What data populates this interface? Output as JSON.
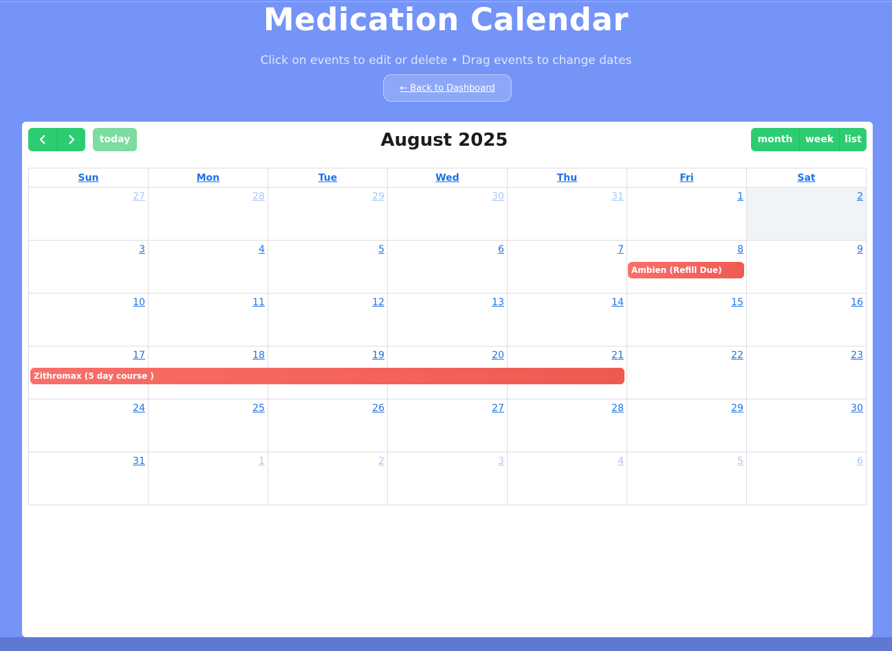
{
  "header": {
    "title": "Medication Calendar",
    "subtitle": "Click on events to edit or delete • Drag events to change dates",
    "back_label": "← Back to Dashboard"
  },
  "toolbar": {
    "prev_icon": "chevron-left-icon",
    "next_icon": "chevron-right-icon",
    "today_label": "today",
    "title": "August 2025",
    "views": [
      "month",
      "week",
      "list"
    ]
  },
  "calendar": {
    "weekdays": [
      "Sun",
      "Mon",
      "Tue",
      "Wed",
      "Thu",
      "Fri",
      "Sat"
    ],
    "weeks": [
      [
        {
          "d": "27",
          "o": true
        },
        {
          "d": "28",
          "o": true
        },
        {
          "d": "29",
          "o": true
        },
        {
          "d": "30",
          "o": true
        },
        {
          "d": "31",
          "o": true
        },
        {
          "d": "1"
        },
        {
          "d": "2",
          "today": true
        }
      ],
      [
        {
          "d": "3"
        },
        {
          "d": "4"
        },
        {
          "d": "5"
        },
        {
          "d": "6"
        },
        {
          "d": "7"
        },
        {
          "d": "8"
        },
        {
          "d": "9"
        }
      ],
      [
        {
          "d": "10"
        },
        {
          "d": "11"
        },
        {
          "d": "12"
        },
        {
          "d": "13"
        },
        {
          "d": "14"
        },
        {
          "d": "15"
        },
        {
          "d": "16"
        }
      ],
      [
        {
          "d": "17"
        },
        {
          "d": "18"
        },
        {
          "d": "19"
        },
        {
          "d": "20"
        },
        {
          "d": "21"
        },
        {
          "d": "22"
        },
        {
          "d": "23"
        }
      ],
      [
        {
          "d": "24"
        },
        {
          "d": "25"
        },
        {
          "d": "26"
        },
        {
          "d": "27"
        },
        {
          "d": "28"
        },
        {
          "d": "29"
        },
        {
          "d": "30"
        }
      ],
      [
        {
          "d": "31"
        },
        {
          "d": "1",
          "o": true
        },
        {
          "d": "2",
          "o": true
        },
        {
          "d": "3",
          "o": true
        },
        {
          "d": "4",
          "o": true
        },
        {
          "d": "5",
          "o": true
        },
        {
          "d": "6",
          "o": true
        }
      ]
    ],
    "events": [
      {
        "title": "Ambien (Refill Due)",
        "start": "2025-08-08",
        "end": "2025-08-08"
      },
      {
        "title": "Zithromax (5 day course )",
        "start": "2025-08-17",
        "end": "2025-08-21"
      }
    ]
  },
  "colors": {
    "background": "#7494f8",
    "button_green": "#2ecc71",
    "event_red": "#f2625c",
    "link_blue": "#1a73e8"
  }
}
